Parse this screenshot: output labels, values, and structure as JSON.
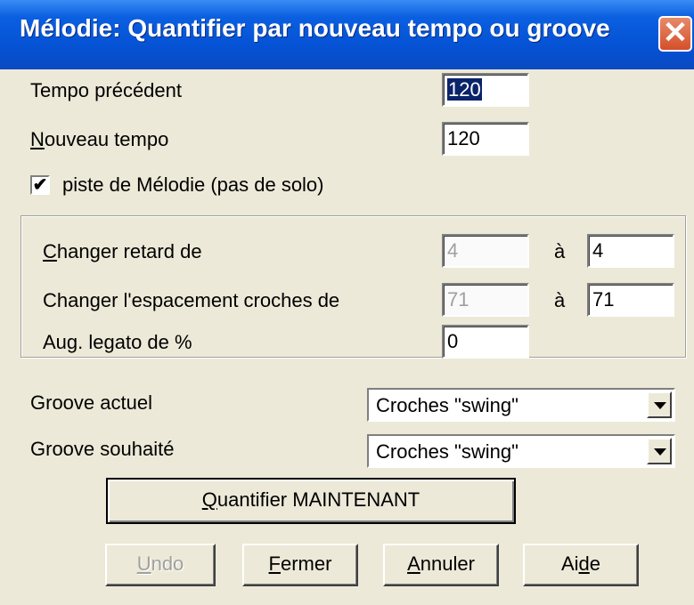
{
  "window": {
    "title": "Mélodie: Quantifier par nouveau tempo ou groove",
    "close": "✕"
  },
  "tempo": {
    "previous_label": "Tempo précédent",
    "previous_value": "120",
    "new_label_accel": "N",
    "new_label_rest": "ouveau tempo",
    "new_value": "120"
  },
  "melody_track": {
    "checked": true,
    "check_mark": "✔",
    "label": "piste de Mélodie (pas de solo)"
  },
  "group": {
    "delay_label_accel": "C",
    "delay_label_rest": "hanger retard de",
    "delay_from": "4",
    "delay_to_word": "à",
    "delay_to": "4",
    "spacing_label": "Changer l'espacement croches de",
    "spacing_from": "71",
    "spacing_to_word": "à",
    "spacing_to": "71",
    "legato_label": "Aug. legato de %",
    "legato_value": "0"
  },
  "groove": {
    "current_label": "Groove actuel",
    "current_value": "Croches \"swing\"",
    "target_label": "Groove souhaité",
    "target_value": "Croches \"swing\""
  },
  "buttons": {
    "quantize_accel": "Q",
    "quantize_rest": "uantifier MAINTENANT",
    "undo_accel": "U",
    "undo_rest": "ndo",
    "close_accel": "F",
    "close_rest": "ermer",
    "cancel_accel": "A",
    "cancel_rest": "nnuler",
    "help_pre": "Ai",
    "help_accel": "d",
    "help_post": "e"
  }
}
